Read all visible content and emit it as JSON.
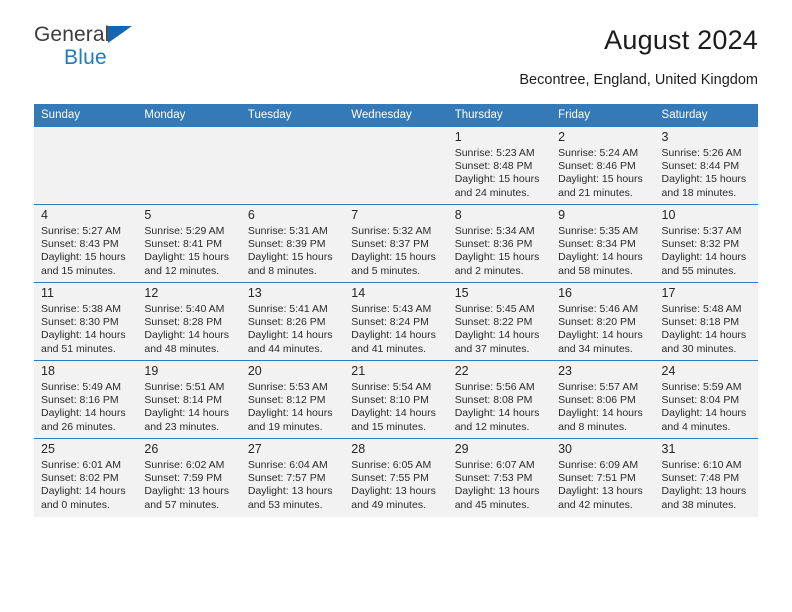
{
  "brand": {
    "name_top": "General",
    "name_bottom": "Blue",
    "triangle_color": "#1565b0",
    "blue_text_color": "#1f7ac4"
  },
  "header": {
    "title": "August 2024",
    "subtitle": "Becontree, England, United Kingdom",
    "header_bg_color": "#3479b8",
    "shaded_row_color": "#f2f2f2"
  },
  "calendar": {
    "weekday_headers": [
      "Sunday",
      "Monday",
      "Tuesday",
      "Wednesday",
      "Thursday",
      "Friday",
      "Saturday"
    ],
    "weeks": [
      [
        {
          "day": "",
          "info": ""
        },
        {
          "day": "",
          "info": ""
        },
        {
          "day": "",
          "info": ""
        },
        {
          "day": "",
          "info": ""
        },
        {
          "day": "1",
          "info": "Sunrise: 5:23 AM\nSunset: 8:48 PM\nDaylight: 15 hours\nand 24 minutes."
        },
        {
          "day": "2",
          "info": "Sunrise: 5:24 AM\nSunset: 8:46 PM\nDaylight: 15 hours\nand 21 minutes."
        },
        {
          "day": "3",
          "info": "Sunrise: 5:26 AM\nSunset: 8:44 PM\nDaylight: 15 hours\nand 18 minutes."
        }
      ],
      [
        {
          "day": "4",
          "info": "Sunrise: 5:27 AM\nSunset: 8:43 PM\nDaylight: 15 hours\nand 15 minutes."
        },
        {
          "day": "5",
          "info": "Sunrise: 5:29 AM\nSunset: 8:41 PM\nDaylight: 15 hours\nand 12 minutes."
        },
        {
          "day": "6",
          "info": "Sunrise: 5:31 AM\nSunset: 8:39 PM\nDaylight: 15 hours\nand 8 minutes."
        },
        {
          "day": "7",
          "info": "Sunrise: 5:32 AM\nSunset: 8:37 PM\nDaylight: 15 hours\nand 5 minutes."
        },
        {
          "day": "8",
          "info": "Sunrise: 5:34 AM\nSunset: 8:36 PM\nDaylight: 15 hours\nand 2 minutes."
        },
        {
          "day": "9",
          "info": "Sunrise: 5:35 AM\nSunset: 8:34 PM\nDaylight: 14 hours\nand 58 minutes."
        },
        {
          "day": "10",
          "info": "Sunrise: 5:37 AM\nSunset: 8:32 PM\nDaylight: 14 hours\nand 55 minutes."
        }
      ],
      [
        {
          "day": "11",
          "info": "Sunrise: 5:38 AM\nSunset: 8:30 PM\nDaylight: 14 hours\nand 51 minutes."
        },
        {
          "day": "12",
          "info": "Sunrise: 5:40 AM\nSunset: 8:28 PM\nDaylight: 14 hours\nand 48 minutes."
        },
        {
          "day": "13",
          "info": "Sunrise: 5:41 AM\nSunset: 8:26 PM\nDaylight: 14 hours\nand 44 minutes."
        },
        {
          "day": "14",
          "info": "Sunrise: 5:43 AM\nSunset: 8:24 PM\nDaylight: 14 hours\nand 41 minutes."
        },
        {
          "day": "15",
          "info": "Sunrise: 5:45 AM\nSunset: 8:22 PM\nDaylight: 14 hours\nand 37 minutes."
        },
        {
          "day": "16",
          "info": "Sunrise: 5:46 AM\nSunset: 8:20 PM\nDaylight: 14 hours\nand 34 minutes."
        },
        {
          "day": "17",
          "info": "Sunrise: 5:48 AM\nSunset: 8:18 PM\nDaylight: 14 hours\nand 30 minutes."
        }
      ],
      [
        {
          "day": "18",
          "info": "Sunrise: 5:49 AM\nSunset: 8:16 PM\nDaylight: 14 hours\nand 26 minutes."
        },
        {
          "day": "19",
          "info": "Sunrise: 5:51 AM\nSunset: 8:14 PM\nDaylight: 14 hours\nand 23 minutes."
        },
        {
          "day": "20",
          "info": "Sunrise: 5:53 AM\nSunset: 8:12 PM\nDaylight: 14 hours\nand 19 minutes."
        },
        {
          "day": "21",
          "info": "Sunrise: 5:54 AM\nSunset: 8:10 PM\nDaylight: 14 hours\nand 15 minutes."
        },
        {
          "day": "22",
          "info": "Sunrise: 5:56 AM\nSunset: 8:08 PM\nDaylight: 14 hours\nand 12 minutes."
        },
        {
          "day": "23",
          "info": "Sunrise: 5:57 AM\nSunset: 8:06 PM\nDaylight: 14 hours\nand 8 minutes."
        },
        {
          "day": "24",
          "info": "Sunrise: 5:59 AM\nSunset: 8:04 PM\nDaylight: 14 hours\nand 4 minutes."
        }
      ],
      [
        {
          "day": "25",
          "info": "Sunrise: 6:01 AM\nSunset: 8:02 PM\nDaylight: 14 hours\nand 0 minutes."
        },
        {
          "day": "26",
          "info": "Sunrise: 6:02 AM\nSunset: 7:59 PM\nDaylight: 13 hours\nand 57 minutes."
        },
        {
          "day": "27",
          "info": "Sunrise: 6:04 AM\nSunset: 7:57 PM\nDaylight: 13 hours\nand 53 minutes."
        },
        {
          "day": "28",
          "info": "Sunrise: 6:05 AM\nSunset: 7:55 PM\nDaylight: 13 hours\nand 49 minutes."
        },
        {
          "day": "29",
          "info": "Sunrise: 6:07 AM\nSunset: 7:53 PM\nDaylight: 13 hours\nand 45 minutes."
        },
        {
          "day": "30",
          "info": "Sunrise: 6:09 AM\nSunset: 7:51 PM\nDaylight: 13 hours\nand 42 minutes."
        },
        {
          "day": "31",
          "info": "Sunrise: 6:10 AM\nSunset: 7:48 PM\nDaylight: 13 hours\nand 38 minutes."
        }
      ]
    ]
  }
}
